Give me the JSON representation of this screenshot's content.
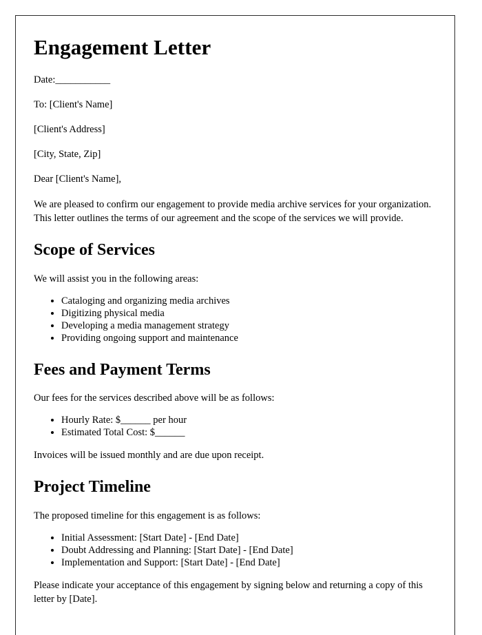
{
  "document": {
    "title": "Engagement Letter",
    "header": {
      "date_label": "Date:",
      "date_blank": "___________",
      "to_line": "To: [Client's Name]",
      "address_line": "[Client's Address]",
      "city_state_zip_line": "[City, State, Zip]",
      "salutation": "Dear [Client's Name],"
    },
    "intro_paragraph": "We are pleased to confirm our engagement to provide media archive services for your organization. This letter outlines the terms of our agreement and the scope of the services we will provide.",
    "sections": [
      {
        "heading": "Scope of Services",
        "lead": "We will assist you in the following areas:",
        "items": [
          "Cataloging and organizing media archives",
          "Digitizing physical media",
          "Developing a media management strategy",
          "Providing ongoing support and maintenance"
        ]
      },
      {
        "heading": "Fees and Payment Terms",
        "lead": "Our fees for the services described above will be as follows:",
        "items": [
          "Hourly Rate: $______ per hour",
          "Estimated Total Cost: $______"
        ],
        "closing": "Invoices will be issued monthly and are due upon receipt."
      },
      {
        "heading": "Project Timeline",
        "lead": "The proposed timeline for this engagement is as follows:",
        "items": [
          "Initial Assessment: [Start Date] - [End Date]",
          "Doubt Addressing and Planning: [Start Date] - [End Date]",
          "Implementation and Support: [Start Date] - [End Date]"
        ]
      }
    ],
    "acceptance_paragraph": "Please indicate your acceptance of this engagement by signing below and returning a copy of this letter by [Date]."
  },
  "colors": {
    "page_background": "#ffffff",
    "text": "#000000",
    "border": "#2b2b2b"
  }
}
